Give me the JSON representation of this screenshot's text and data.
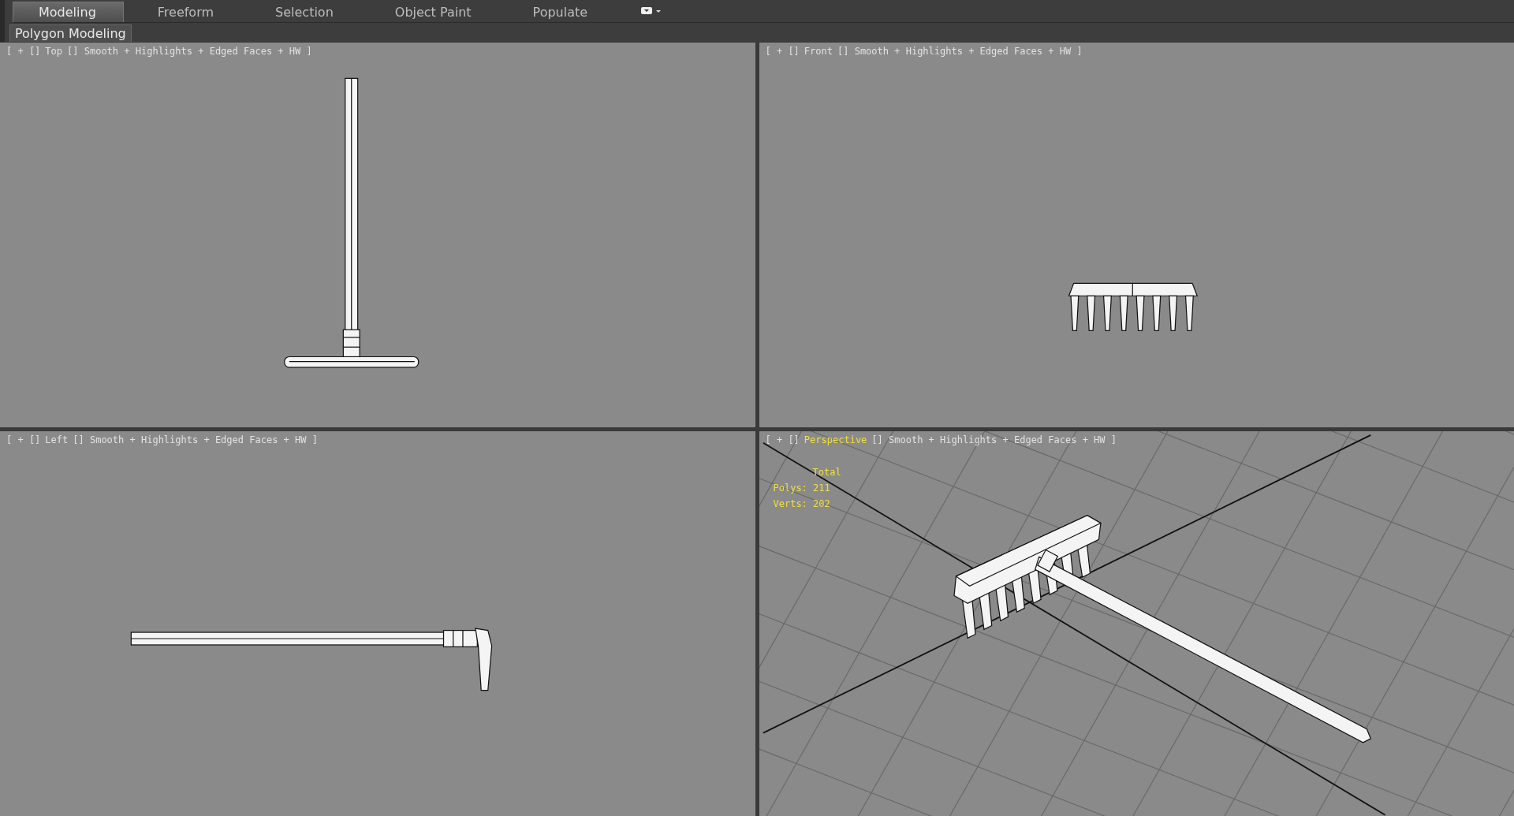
{
  "ribbon": {
    "tabs": [
      {
        "label": "Modeling",
        "selected": true
      },
      {
        "label": "Freeform",
        "selected": false
      },
      {
        "label": "Selection",
        "selected": false
      },
      {
        "label": "Object Paint",
        "selected": false
      },
      {
        "label": "Populate",
        "selected": false
      }
    ],
    "panel_tab": "Polygon Modeling"
  },
  "viewports": [
    {
      "kind": "top",
      "prefix": "[ + []",
      "view": "Top",
      "mode": "[] Smooth + Highlights + Edged Faces + HW ]",
      "active": false
    },
    {
      "kind": "front",
      "prefix": "[ + []",
      "view": "Front",
      "mode": "[] Smooth + Highlights + Edged Faces + HW ]",
      "active": false
    },
    {
      "kind": "left",
      "prefix": "[ + []",
      "view": "Left",
      "mode": "[] Smooth + Highlights + Edged Faces + HW ]",
      "active": false
    },
    {
      "kind": "perspective",
      "prefix": "[ + []",
      "view": "Perspective",
      "mode": "[] Smooth + Highlights + Edged Faces + HW ]",
      "active": true,
      "stats": {
        "title": "Total",
        "lines": [
          "Polys: 211",
          "Verts: 202"
        ]
      }
    }
  ]
}
